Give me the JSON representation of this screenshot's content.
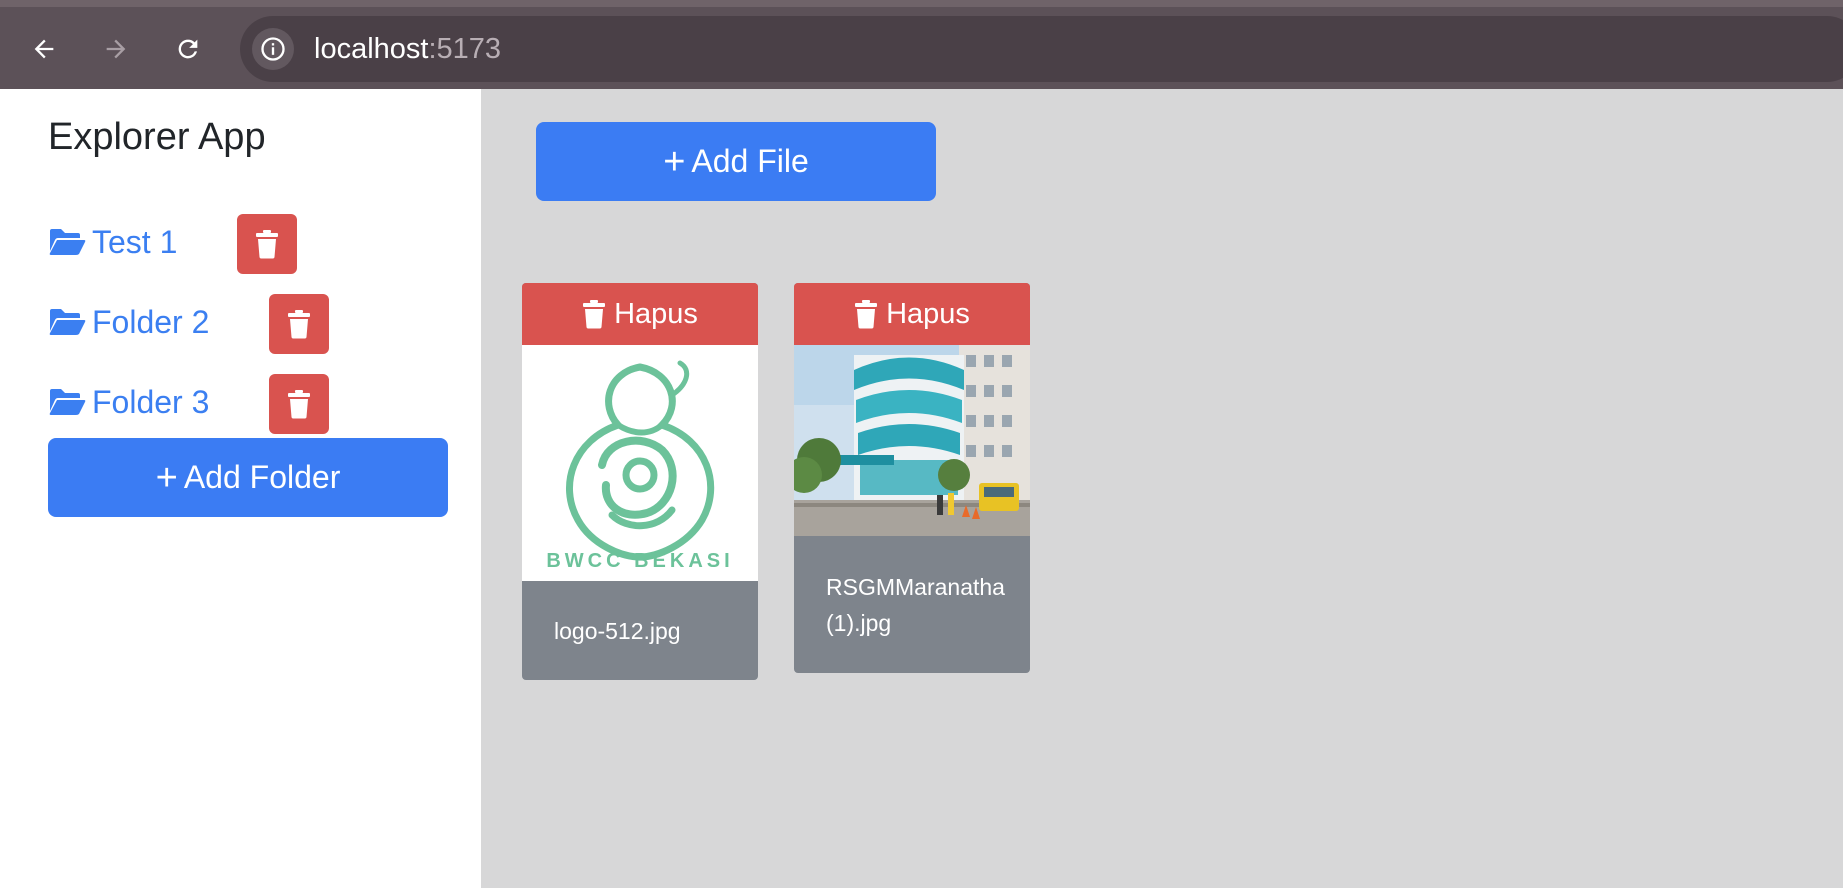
{
  "browser": {
    "url_host": "localhost",
    "url_port": ":5173",
    "back_icon": "arrow-left-icon",
    "forward_icon": "arrow-right-icon",
    "reload_icon": "reload-icon",
    "info_icon": "info-icon"
  },
  "sidebar": {
    "title": "Explorer App",
    "folders": [
      {
        "label": "Test 1"
      },
      {
        "label": "Folder 2"
      },
      {
        "label": "Folder 3"
      }
    ],
    "add_folder_label": "Add Folder",
    "folder_icon": "folder-open-icon",
    "delete_icon": "trash-icon"
  },
  "main": {
    "add_file_label": "Add File",
    "files": [
      {
        "name": "logo-512.jpg",
        "delete_label": "Hapus",
        "logo_text": "BWCC BEKASI"
      },
      {
        "name": "RSGMMaranatha (1).jpg",
        "delete_label": "Hapus"
      }
    ]
  },
  "colors": {
    "primary": "#3b7cf3",
    "danger": "#d9534f",
    "card_footer": "#7e848c",
    "main_bg": "#d7d7d8",
    "chrome_bg": "#5c5158",
    "link": "#3b7ff1",
    "logo_green": "#6cc29a"
  }
}
